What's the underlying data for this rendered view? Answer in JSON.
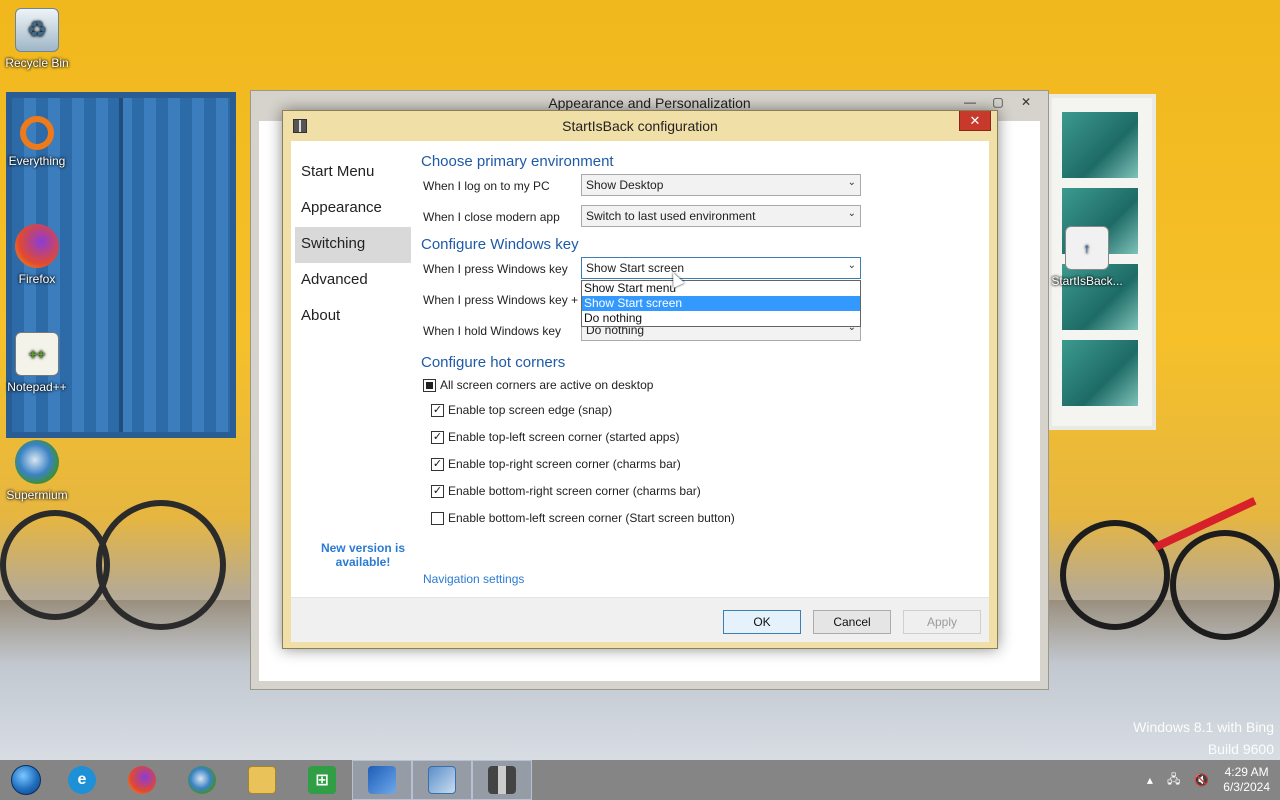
{
  "desktop": {
    "icons": [
      {
        "label": "Recycle Bin",
        "icon": "recycle-bin-icon"
      },
      {
        "label": "Everything",
        "icon": "everything-icon"
      },
      {
        "label": "Firefox",
        "icon": "firefox-icon"
      },
      {
        "label": "Notepad++",
        "icon": "notepad-plus-plus-icon"
      },
      {
        "label": "Supermium",
        "icon": "supermium-icon"
      },
      {
        "label": "StartIsBack...",
        "icon": "startisback-file-icon"
      }
    ],
    "watermark": {
      "line1": "Windows 8.1 with Bing",
      "line2": "Build 9600"
    }
  },
  "background_window": {
    "title": "Appearance and Personalization",
    "controls": {
      "minimize": "—",
      "maximize": "▢",
      "close": "✕"
    }
  },
  "dialog": {
    "title": "StartIsBack configuration",
    "close_label": "✕",
    "nav": [
      {
        "label": "Start Menu"
      },
      {
        "label": "Appearance"
      },
      {
        "label": "Switching"
      },
      {
        "label": "Advanced"
      },
      {
        "label": "About"
      }
    ],
    "selected_nav": "Switching",
    "new_version": "New version is available!",
    "sections": {
      "primary": {
        "title": "Choose primary environment",
        "rows": [
          {
            "label": "When I log on to my PC",
            "value": "Show Desktop"
          },
          {
            "label": "When I close modern app",
            "value": "Switch to last used environment"
          }
        ]
      },
      "windows_key": {
        "title": "Configure Windows key",
        "rows": [
          {
            "label": "When I press Windows key",
            "value": "Show Start screen"
          },
          {
            "label": "When I press Windows key +",
            "value": ""
          },
          {
            "label": "When I hold Windows key",
            "value": "Do nothing"
          }
        ],
        "dropdown_options": [
          "Show Start menu",
          "Show Start screen",
          "Do nothing"
        ],
        "dropdown_highlighted": "Show Start screen"
      },
      "hot_corners": {
        "title": "Configure hot corners",
        "master": {
          "label": "All screen corners are active on desktop",
          "state": "indeterminate"
        },
        "items": [
          {
            "label": "Enable top screen edge (snap)",
            "checked": true
          },
          {
            "label": "Enable top-left screen corner (started apps)",
            "checked": true
          },
          {
            "label": "Enable top-right screen corner (charms bar)",
            "checked": true
          },
          {
            "label": "Enable bottom-right screen corner (charms bar)",
            "checked": true
          },
          {
            "label": "Enable bottom-left screen corner (Start screen button)",
            "checked": false
          }
        ]
      }
    },
    "navigation_link": "Navigation settings",
    "buttons": {
      "ok": "OK",
      "cancel": "Cancel",
      "apply": "Apply"
    }
  },
  "taskbar": {
    "apps": [
      {
        "name": "Internet Explorer",
        "icon": "internet-explorer-icon"
      },
      {
        "name": "Firefox",
        "icon": "firefox-icon"
      },
      {
        "name": "Supermium",
        "icon": "supermium-icon"
      },
      {
        "name": "File Explorer",
        "icon": "file-explorer-icon"
      },
      {
        "name": "Store",
        "icon": "store-icon"
      },
      {
        "name": "Personalization",
        "icon": "personalization-icon"
      },
      {
        "name": "Control Panel",
        "icon": "control-panel-icon"
      },
      {
        "name": "StartIsBack",
        "icon": "startisback-icon"
      }
    ],
    "clock": {
      "time": "4:29 AM",
      "date": "6/3/2024"
    }
  }
}
